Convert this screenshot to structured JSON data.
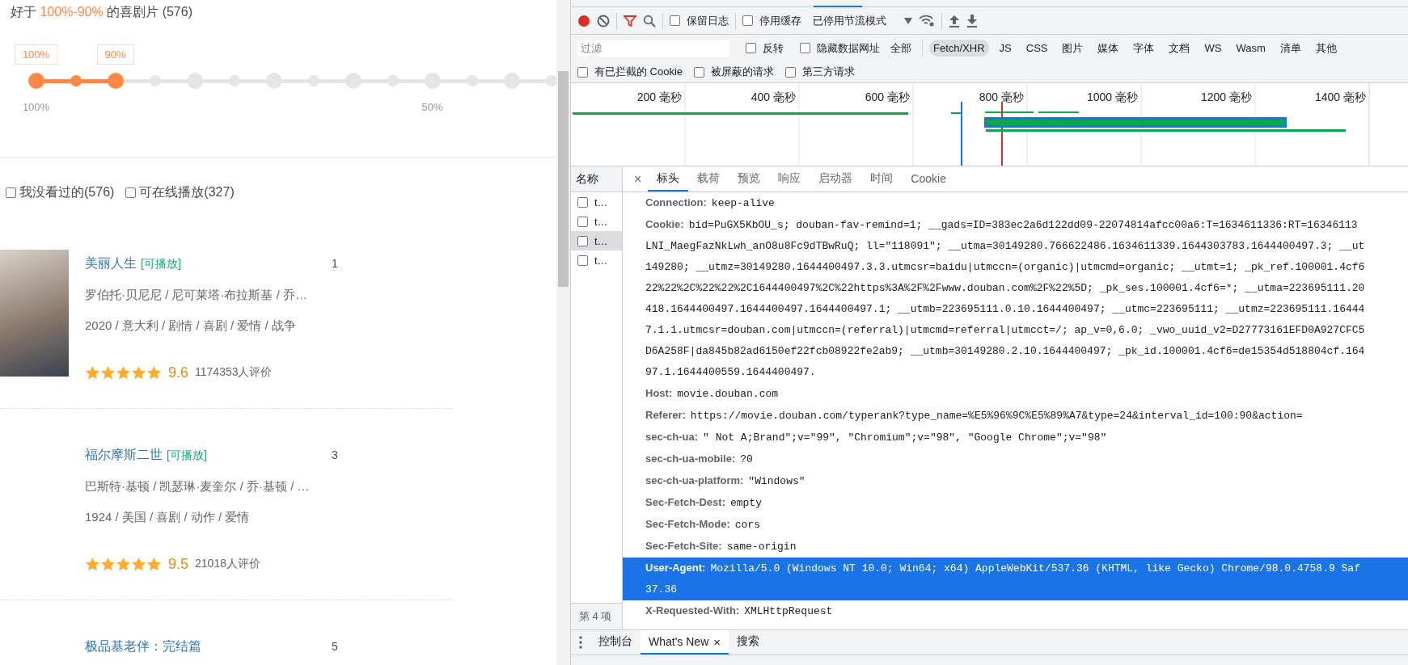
{
  "page": {
    "heading": {
      "prefix": "好于",
      "highlight": "100%-90%",
      "suffix": "的喜剧片 (576)"
    },
    "slider": {
      "dots": [
        {
          "selected": true,
          "handle": "100%",
          "label": "100%"
        },
        {
          "selected": true
        },
        {
          "selected": true,
          "handle": "90%"
        },
        {
          "selected": false
        },
        {
          "selected": false
        },
        {
          "selected": false
        },
        {
          "selected": false
        },
        {
          "selected": false
        },
        {
          "selected": false
        },
        {
          "selected": false
        },
        {
          "selected": false,
          "label": "50%"
        },
        {
          "selected": false
        },
        {
          "selected": false
        },
        {
          "selected": false
        }
      ]
    },
    "filters": [
      {
        "label": "我没看过的(576)",
        "checked": false
      },
      {
        "label": "可在线播放(327)",
        "checked": false
      }
    ],
    "movies": [
      {
        "title": "美丽人生",
        "tag": "[可播放]",
        "rank": "1",
        "poster": true,
        "cast": "罗伯托·贝尼尼 / 尼可莱塔·布拉斯基 / 乔…",
        "info": "2020 / 意大利 / 剧情 / 喜剧 / 爱情 / 战争",
        "stars": 5,
        "score": "9.6",
        "votes": "1174353人评价"
      },
      {
        "title": "福尔摩斯二世",
        "tag": "[可播放]",
        "rank": "3",
        "poster": false,
        "cast": "巴斯特·基顿 / 凯瑟琳·麦奎尔 / 乔·基顿 / …",
        "info": "1924 / 美国 / 喜剧 / 动作 / 爱情",
        "stars": 5,
        "score": "9.5",
        "votes": "21018人评价"
      },
      {
        "title": "极品基老伴：完结篇",
        "rank": "5",
        "poster": false
      }
    ]
  },
  "devtools": {
    "toolbar": {
      "recording": true,
      "checkboxes": [
        {
          "label": "保留日志",
          "checked": false
        },
        {
          "label": "停用缓存",
          "checked": false
        }
      ],
      "throttle": "已停用节流模式"
    },
    "filter_bar": {
      "placeholder": "过滤",
      "checkboxes": [
        {
          "label": "反转",
          "checked": false
        },
        {
          "label": "隐藏数据网址",
          "checked": false
        }
      ],
      "types": [
        {
          "label": "全部",
          "selected": false
        },
        {
          "label": "Fetch/XHR",
          "selected": true
        },
        {
          "label": "JS",
          "selected": false
        },
        {
          "label": "CSS",
          "selected": false
        },
        {
          "label": "图片",
          "selected": false
        },
        {
          "label": "媒体",
          "selected": false
        },
        {
          "label": "字体",
          "selected": false
        },
        {
          "label": "文档",
          "selected": false
        },
        {
          "label": "WS",
          "selected": false
        },
        {
          "label": "Wasm",
          "selected": false
        },
        {
          "label": "清单",
          "selected": false
        },
        {
          "label": "其他",
          "selected": false
        }
      ]
    },
    "extra_filters": [
      {
        "label": "有已拦截的 Cookie",
        "checked": false
      },
      {
        "label": "被屏蔽的请求",
        "checked": false
      },
      {
        "label": "第三方请求",
        "checked": false
      }
    ],
    "timeline": {
      "ticks": [
        "200 毫秒",
        "400 毫秒",
        "600 毫秒",
        "800 毫秒",
        "1000 毫秒",
        "1200 毫秒",
        "1400 毫秒"
      ]
    },
    "requests": {
      "header": "名称",
      "rows": [
        {
          "name": "t…",
          "checked": false,
          "selected": false
        },
        {
          "name": "t…",
          "checked": false,
          "selected": false
        },
        {
          "name": "t…",
          "checked": false,
          "selected": true
        },
        {
          "name": "t…",
          "checked": false,
          "selected": false
        }
      ],
      "footer": "第 4 项"
    },
    "detail_close": "×",
    "detail_tabs": [
      {
        "label": "标头",
        "selected": true
      },
      {
        "label": "载荷",
        "selected": false
      },
      {
        "label": "预览",
        "selected": false
      },
      {
        "label": "响应",
        "selected": false
      },
      {
        "label": "启动器",
        "selected": false
      },
      {
        "label": "时间",
        "selected": false
      },
      {
        "label": "Cookie",
        "selected": false
      }
    ],
    "headers": [
      {
        "name": "Connection:",
        "lines": [
          "keep-alive"
        ],
        "selected": false
      },
      {
        "name": "Cookie:",
        "lines": [
          "bid=PuGX5KbOU_s; douban-fav-remind=1; __gads=ID=383ec2a6d122dd09-22074814afcc00a6:T=1634611336:RT=16346113",
          "LNI_MaegFazNkLwh_anO8u8Fc9dTBwRuQ; ll=\"118091\"; __utma=30149280.766622486.1634611339.1644303783.1644400497.3; __ut",
          "149280; __utmz=30149280.1644400497.3.3.utmcsr=baidu|utmccn=(organic)|utmcmd=organic; __utmt=1; _pk_ref.100001.4cf6",
          "22%22%2C%22%22%2C1644400497%2C%22https%3A%2F%2Fwww.douban.com%2F%22%5D; _pk_ses.100001.4cf6=*; __utma=223695111.20",
          "418.1644400497.1644400497.1644400497.1; __utmb=223695111.0.10.1644400497; __utmc=223695111; __utmz=223695111.16444",
          "7.1.1.utmcsr=douban.com|utmccn=(referral)|utmcmd=referral|utmcct=/; ap_v=0,6.0; _vwo_uuid_v2=D27773161EFD0A927CFC5",
          "D6A258F|da845b82ad6150ef22fcb08922fe2ab9; __utmb=30149280.2.10.1644400497; _pk_id.100001.4cf6=de15354d518804cf.164",
          "97.1.1644400559.1644400497."
        ],
        "selected": false
      },
      {
        "name": "Host:",
        "lines": [
          "movie.douban.com"
        ],
        "selected": false
      },
      {
        "name": "Referer:",
        "lines": [
          "https://movie.douban.com/typerank?type_name=%E5%96%9C%E5%89%A7&type=24&interval_id=100:90&action="
        ],
        "selected": false
      },
      {
        "name": "sec-ch-ua:",
        "lines": [
          "\" Not A;Brand\";v=\"99\", \"Chromium\";v=\"98\", \"Google Chrome\";v=\"98\""
        ],
        "selected": false
      },
      {
        "name": "sec-ch-ua-mobile:",
        "lines": [
          "?0"
        ],
        "selected": false
      },
      {
        "name": "sec-ch-ua-platform:",
        "lines": [
          "\"Windows\""
        ],
        "selected": false
      },
      {
        "name": "Sec-Fetch-Dest:",
        "lines": [
          "empty"
        ],
        "selected": false
      },
      {
        "name": "Sec-Fetch-Mode:",
        "lines": [
          "cors"
        ],
        "selected": false
      },
      {
        "name": "Sec-Fetch-Site:",
        "lines": [
          "same-origin"
        ],
        "selected": false
      },
      {
        "name": "User-Agent:",
        "lines": [
          "Mozilla/5.0 (Windows NT 10.0; Win64; x64) AppleWebKit/537.36 (KHTML, like Gecko) Chrome/98.0.4758.9 Saf",
          "37.36"
        ],
        "selected": true
      },
      {
        "name": "X-Requested-With:",
        "lines": [
          "XMLHttpRequest"
        ],
        "selected": false
      }
    ],
    "drawer_tabs": [
      {
        "label": "控制台",
        "selected": false
      },
      {
        "label": "What's New",
        "selected": true,
        "close": "×"
      },
      {
        "label": "搜索",
        "selected": false
      }
    ]
  }
}
